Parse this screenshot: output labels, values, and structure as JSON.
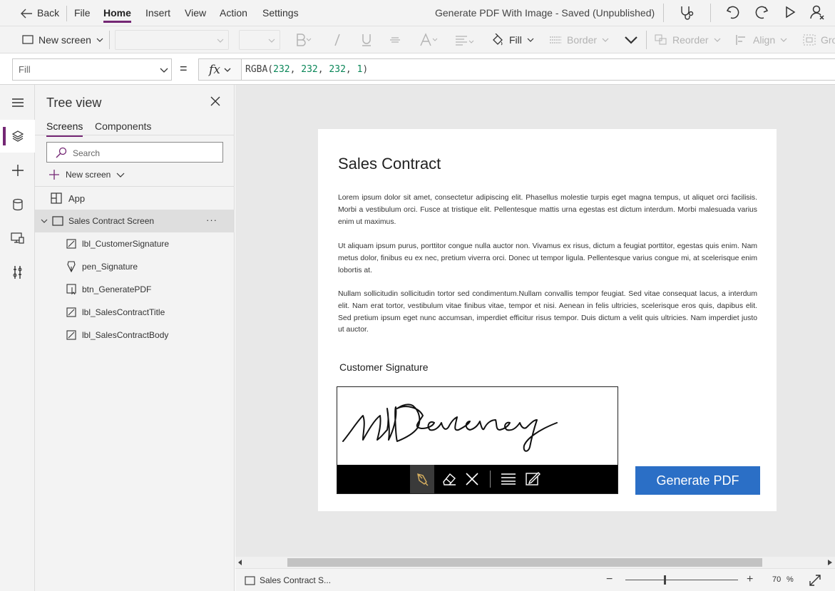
{
  "topbar": {
    "back_label": "Back",
    "menu": [
      {
        "label": "File"
      },
      {
        "label": "Home",
        "active": true
      },
      {
        "label": "Insert"
      },
      {
        "label": "View"
      },
      {
        "label": "Action"
      },
      {
        "label": "Settings"
      }
    ],
    "title": "Generate PDF With Image - Saved (Unpublished)"
  },
  "toolbar": {
    "new_screen_label": "New screen",
    "fill_label": "Fill",
    "border_label": "Border",
    "reorder_label": "Reorder",
    "align_label": "Align",
    "group_label": "Gro"
  },
  "formula": {
    "property": "Fill",
    "equals": "=",
    "fx_label": "fx",
    "fn_name": "RGBA(",
    "args": [
      "232",
      "232",
      "232",
      "1"
    ],
    "sep": ", ",
    "close": ")"
  },
  "tree": {
    "title": "Tree view",
    "tabs": [
      {
        "label": "Screens",
        "active": true
      },
      {
        "label": "Components"
      }
    ],
    "search_placeholder": "Search",
    "new_screen_label": "New screen",
    "app_label": "App",
    "screen_label": "Sales Contract Screen",
    "more_label": "···",
    "children": [
      {
        "label": "lbl_CustomerSignature",
        "icon": "label-icon"
      },
      {
        "label": "pen_Signature",
        "icon": "pen-icon"
      },
      {
        "label": "btn_GeneratePDF",
        "icon": "button-icon"
      },
      {
        "label": "lbl_SalesContractTitle",
        "icon": "label-icon"
      },
      {
        "label": "lbl_SalesContractBody",
        "icon": "label-icon"
      }
    ]
  },
  "canvas": {
    "background_color": "#e8e8e8",
    "title": "Sales Contract",
    "paragraphs": [
      "Lorem ipsum dolor sit amet, consectetur adipiscing elit. Phasellus molestie turpis eget magna tempus, ut aliquet orci facilisis. Morbi a vestibulum orci. Fusce at tristique elit. Pellentesque mattis urna egestas est dictum interdum. Morbi malesuada varius enim ut maximus.",
      "Ut aliquam ipsum purus, porttitor congue nulla auctor non. Vivamus ex risus, dictum a feugiat porttitor, egestas quis enim. Nam metus dolor, finibus eu ex nec, pretium viverra orci. Donec ut tempor ligula. Pellentesque varius congue mi, at scelerisque enim lobortis at.",
      "Nullam sollicitudin sollicitudin tortor sed condimentum.Nullam convallis tempor feugiat. Sed vitae consequat lacus, a interdum elit. Nam erat tortor, vestibulum vitae finibus vitae, tempor et nisi. Aenean in felis ultricies, scelerisque eros quis, dapibus elit. Sed pretium ipsum eget nunc accumsan, imperdiet efficitur risus tempor. Duis dictum a velit quis ultricies. Nam imperdiet justo ut auctor."
    ],
    "signature_label": "Customer Signature",
    "signature_text": "MHDevaney",
    "generate_button": "Generate PDF",
    "button_color": "#2b6fc6"
  },
  "status": {
    "screen_label": "Sales Contract S...",
    "zoom_minus": "−",
    "zoom_plus": "+",
    "zoom_value": "70",
    "zoom_unit": "%",
    "zoom_level": 0.7
  },
  "colors": {
    "accent": "#742774",
    "canvas": "#e8e8e8",
    "button": "#2b6fc6"
  }
}
